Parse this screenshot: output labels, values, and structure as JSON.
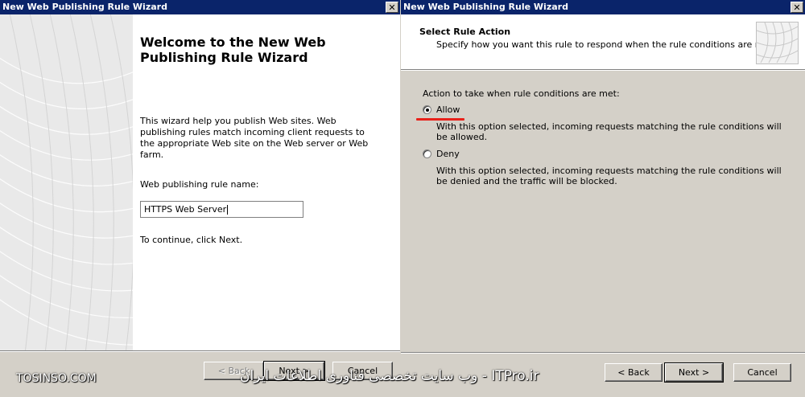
{
  "left_wizard": {
    "title": "New Web Publishing Rule Wizard",
    "close_label": "✕",
    "welcome_title": "Welcome to the New Web Publishing Rule Wizard",
    "intro_text": "This wizard help you publish Web sites. Web publishing rules match incoming client requests to the appropriate Web site on the Web server or Web farm.",
    "rule_name_label": "Web publishing rule name:",
    "rule_name_value": "HTTPS Web Server",
    "continue_text": "To continue, click Next.",
    "buttons": {
      "back": "< Back",
      "next": "Next >",
      "cancel": "Cancel"
    }
  },
  "right_wizard": {
    "title": "New Web Publishing Rule Wizard",
    "close_label": "✕",
    "header_title": "Select Rule Action",
    "header_subtitle": "Specify how you want this rule to respond when the rule conditions are met.",
    "action_label": "Action to take when rule conditions are met:",
    "options": [
      {
        "label": "Allow",
        "selected": true,
        "description": "With this option selected, incoming requests matching the rule conditions will be allowed."
      },
      {
        "label": "Deny",
        "selected": false,
        "description": "With this option selected, incoming requests matching the rule conditions will be denied and the traffic will be blocked."
      }
    ],
    "buttons": {
      "back": "< Back",
      "next": "Next >",
      "cancel": "Cancel"
    }
  },
  "watermark": {
    "left": "TOSINSO.COM",
    "right": "ITPro.ir - وب سایت تخصصی فناوری اطلاعات ایران"
  },
  "colors": {
    "titlebar": "#0a246a",
    "highlight_mark": "#e8211a",
    "dialog_bg": "#d4d0c8"
  },
  "icons": {
    "close": "close-icon",
    "wizard_art": "wizard-wave-art",
    "header_art": "wizard-header-art"
  }
}
